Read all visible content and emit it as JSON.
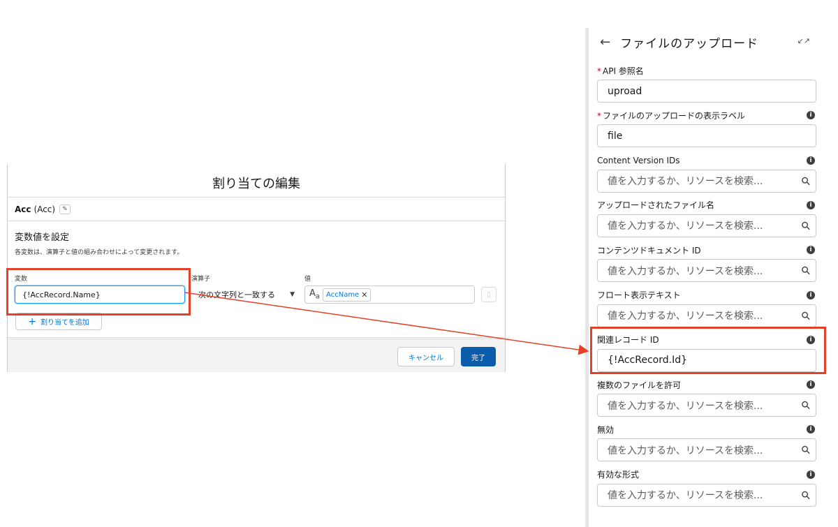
{
  "modal": {
    "title": "割り当ての編集",
    "element_name": "Acc",
    "element_api": "(Acc)",
    "section_title": "変数値を設定",
    "section_desc": "各変数は、演算子と値の組み合わせによって変更されます。",
    "columns": {
      "variable": "変数",
      "operator": "演算子",
      "value": "値"
    },
    "row": {
      "variable": "{!AccRecord.Name}",
      "operator": "次の文字列と一致する",
      "value_pill": "AccName"
    },
    "add_assignment_label": "割り当てを追加",
    "cancel_label": "キャンセル",
    "done_label": "完了"
  },
  "panel": {
    "title": "ファイルのアップロード",
    "search_placeholder": "値を入力するか、リソースを検索...",
    "fields": [
      {
        "label": "API 参照名",
        "required": true,
        "info": false,
        "value": "uproad"
      },
      {
        "label": "ファイルのアップロードの表示ラベル",
        "required": true,
        "info": true,
        "value": "file"
      },
      {
        "label": "Content Version IDs",
        "required": false,
        "info": true,
        "value": ""
      },
      {
        "label": "アップロードされたファイル名",
        "required": false,
        "info": true,
        "value": ""
      },
      {
        "label": "コンテンツドキュメント ID",
        "required": false,
        "info": true,
        "value": ""
      },
      {
        "label": "フロート表示テキスト",
        "required": false,
        "info": true,
        "value": ""
      },
      {
        "label": "関連レコード ID",
        "required": false,
        "info": true,
        "value": "{!AccRecord.Id}"
      },
      {
        "label": "複数のファイルを許可",
        "required": false,
        "info": true,
        "value": ""
      },
      {
        "label": "無効",
        "required": false,
        "info": true,
        "value": ""
      },
      {
        "label": "有効な形式",
        "required": false,
        "info": true,
        "value": ""
      }
    ]
  },
  "colors": {
    "highlight": "#e5402a",
    "brand": "#0b5cab",
    "link": "#0176d3"
  }
}
